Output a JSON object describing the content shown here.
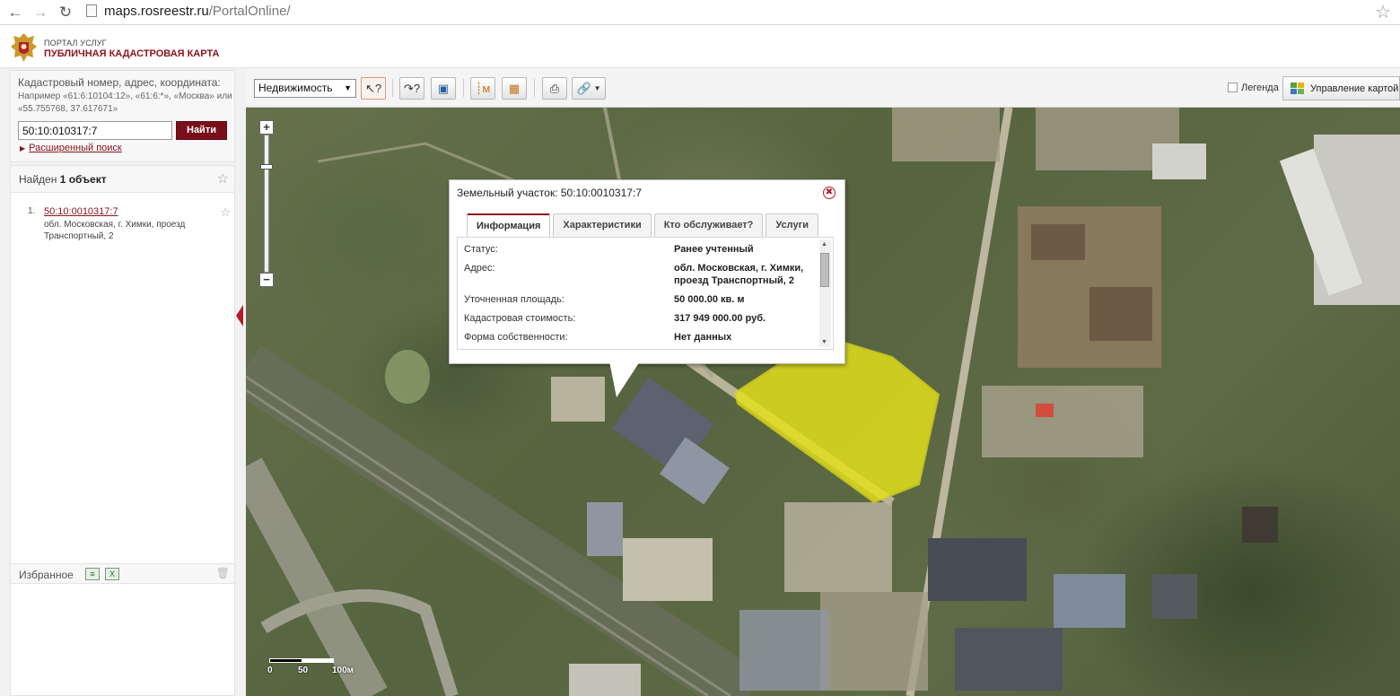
{
  "browser": {
    "back_icon": "arrow-left-icon",
    "forward_icon": "arrow-right-icon",
    "reload_icon": "reload-icon",
    "url_host": "maps.rosreestr.ru",
    "url_path": "/PortalOnline/"
  },
  "header": {
    "portal_label": "ПОРТАЛ УСЛУГ",
    "app_title": "ПУБЛИЧНАЯ КАДАСТРОВАЯ КАРТА"
  },
  "search": {
    "title": "Кадастровый номер, адрес, координата:",
    "hint": "Например «61:6:10104:12», «61:6:*», «Москва» или «55.755768, 37.617671»",
    "value": "50:10:010317:7",
    "button_label": "Найти",
    "advanced_label": "Расширенный поиск"
  },
  "results": {
    "found_prefix": "Найден",
    "found_count": "1 объект",
    "items": [
      {
        "num": "1.",
        "link": "50:10:0010317:7",
        "address": "обл. Московская, г. Химки, проезд Транспортный, 2"
      }
    ]
  },
  "favorites": {
    "title": "Избранное"
  },
  "toolbar": {
    "layer_select": "Недвижимость",
    "legend_label": "Легенда",
    "map_control_label": "Управление картой"
  },
  "map": {
    "scale_labels": [
      "0",
      "50",
      "100м"
    ]
  },
  "popup": {
    "title": "Земельный участок: 50:10:0010317:7",
    "tabs": [
      "Информация",
      "Характеристики",
      "Кто обслуживает?",
      "Услуги"
    ],
    "rows": [
      {
        "label": "Статус:",
        "value": "Ранее учтенный"
      },
      {
        "label": "Адрес:",
        "value": "обл. Московская, г. Химки, проезд Транспортный, 2"
      },
      {
        "label": "Уточненная площадь:",
        "value": "50 000.00 кв. м"
      },
      {
        "label": "Кадастровая стоимость:",
        "value": "317 949 000.00 руб."
      },
      {
        "label": "Форма собственности:",
        "value": "Нет данных"
      }
    ]
  },
  "colors": {
    "brand": "#8b1520",
    "parcel_fill": "#e6e21a"
  }
}
